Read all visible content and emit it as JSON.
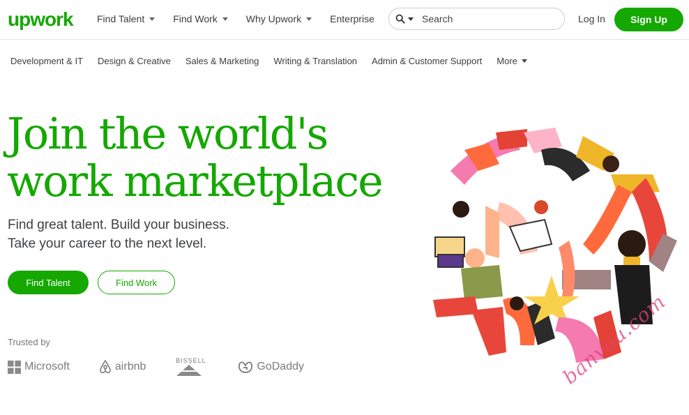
{
  "brand": {
    "logo_text": "upwork",
    "accent_color": "#14a800"
  },
  "header": {
    "nav": [
      {
        "label": "Find Talent",
        "has_dropdown": true
      },
      {
        "label": "Find Work",
        "has_dropdown": true
      },
      {
        "label": "Why Upwork",
        "has_dropdown": true
      },
      {
        "label": "Enterprise",
        "has_dropdown": false
      }
    ],
    "search": {
      "placeholder": "Search",
      "icon": "search-icon"
    },
    "login_label": "Log In",
    "signup_label": "Sign Up"
  },
  "categories": [
    "Development & IT",
    "Design & Creative",
    "Sales & Marketing",
    "Writing & Translation",
    "Admin & Customer Support",
    "More"
  ],
  "hero": {
    "headline_line1": "Join the world's",
    "headline_line2": "work marketplace",
    "subtitle_line1": "Find great talent. Build your business.",
    "subtitle_line2": "Take your career to the next level.",
    "primary_button": "Find Talent",
    "secondary_button": "Find Work"
  },
  "trusted": {
    "label": "Trusted by",
    "brands": [
      {
        "name": "Microsoft",
        "icon": "microsoft-logo"
      },
      {
        "name": "airbnb",
        "icon": "airbnb-logo"
      },
      {
        "name": "BISSELL",
        "icon": "bissell-logo"
      },
      {
        "name": "GoDaddy",
        "icon": "godaddy-logo"
      }
    ]
  },
  "watermark_text": "banvou.com"
}
